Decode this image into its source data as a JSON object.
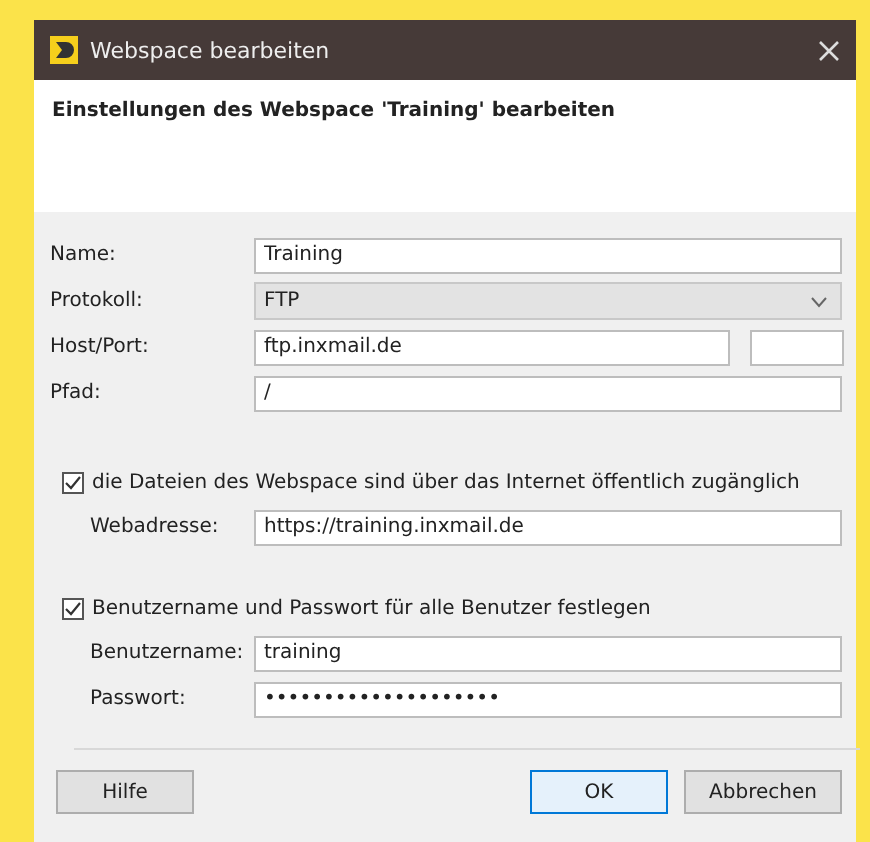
{
  "window": {
    "title": "Webspace bearbeiten"
  },
  "header": {
    "title": "Einstellungen des Webspace 'Training' bearbeiten"
  },
  "fields": [
    {
      "kind": "text",
      "label": "Name:",
      "value": "Training"
    },
    {
      "kind": "select",
      "label": "Protokoll:",
      "value": "FTP"
    },
    {
      "kind": "hostport",
      "label": "Host/Port:",
      "value": "ftp.inxmail.de"
    },
    {
      "kind": "text",
      "label": "Pfad:",
      "value": "/"
    }
  ],
  "sections": [
    {
      "label": "die Dateien des Webspace sind über das Internet öffentlich zugänglich",
      "checked": true,
      "fields": [
        {
          "kind": "text",
          "label": "Webadresse:",
          "value": "https://training.inxmail.de"
        }
      ]
    },
    {
      "label": "Benutzername und Passwort für alle Benutzer festlegen",
      "checked": true,
      "fields": [
        {
          "kind": "text",
          "label": "Benutzername:",
          "value": "training"
        },
        {
          "kind": "text",
          "label": "Passwort:",
          "value": "••••••••••••••••••••"
        }
      ]
    }
  ],
  "buttons": [
    {
      "label": "Hilfe",
      "kind": "help",
      "selected": false
    },
    {
      "label": "OK",
      "kind": "ok",
      "selected": true
    },
    {
      "label": "Abbrechen",
      "kind": "cancel",
      "selected": false
    }
  ]
}
